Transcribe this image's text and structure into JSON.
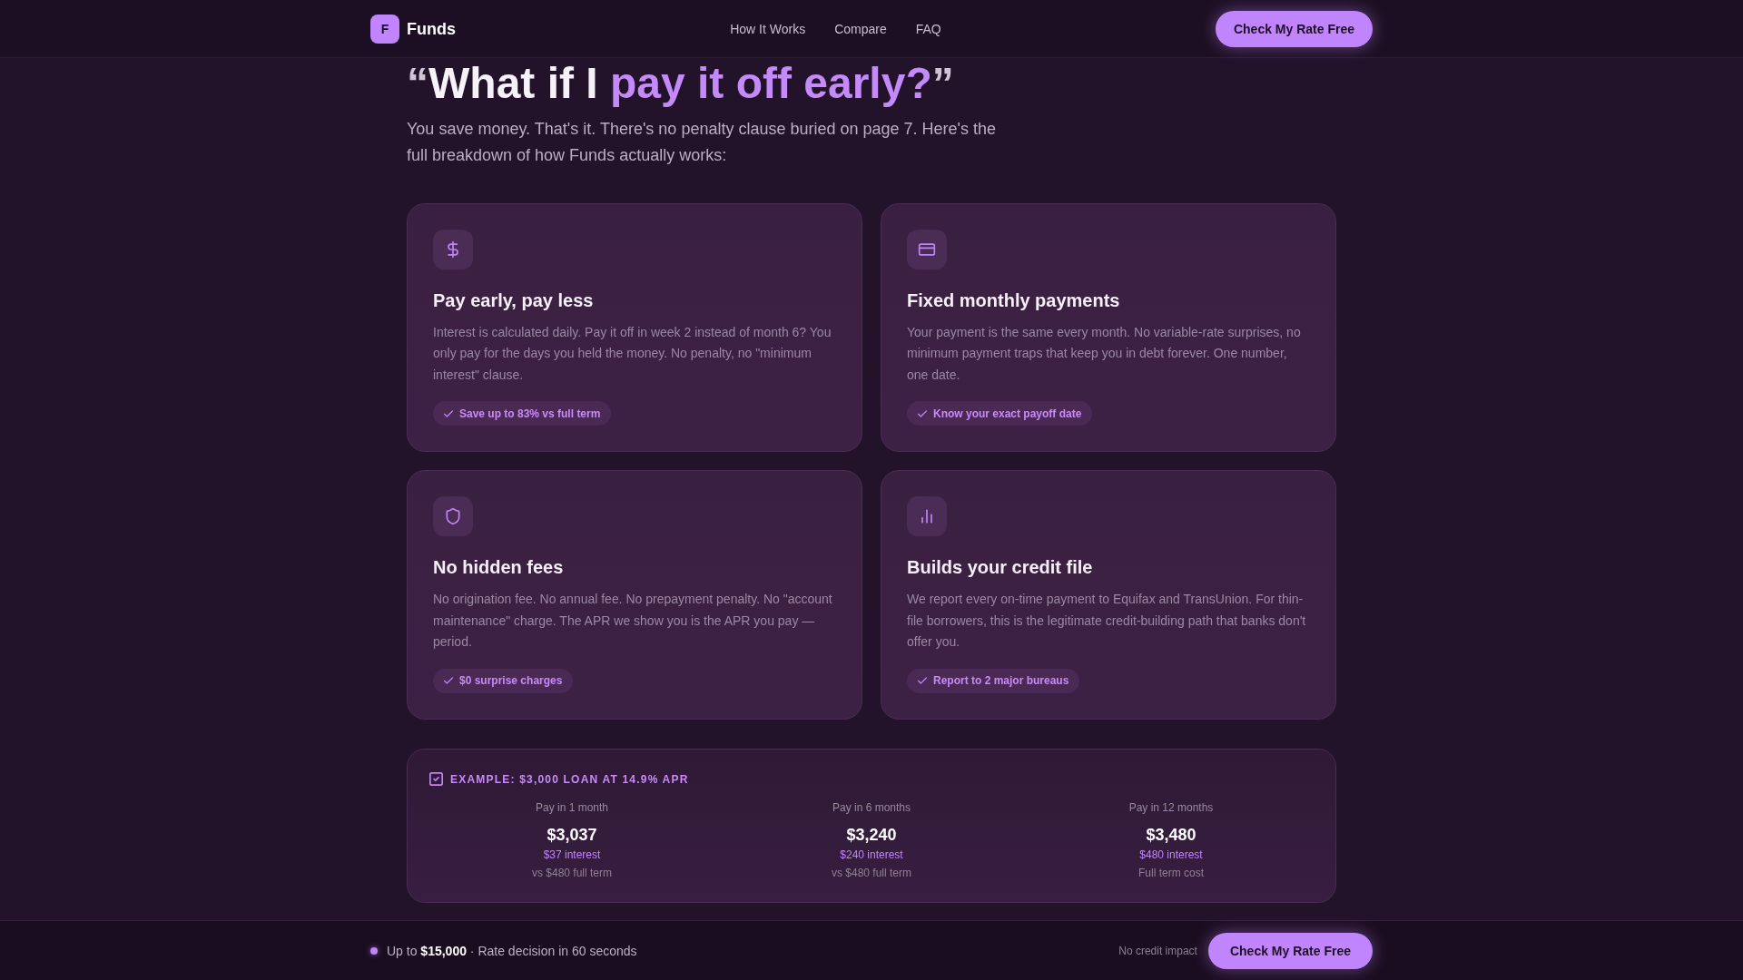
{
  "header": {
    "logo_mark": "F",
    "brand": "Funds",
    "nav": [
      "How It Works",
      "Compare",
      "FAQ"
    ],
    "cta": "Check My Rate Free"
  },
  "hero": {
    "headline": {
      "open_quote": "“",
      "lead": "What if I ",
      "highlight": "pay it off early?",
      "close_quote": "”"
    },
    "intro": "You save money. That's it. There's no penalty clause buried on page 7. Here's the full breakdown of how Funds actually works:"
  },
  "features": [
    {
      "title": "Pay early, pay less",
      "body": "Interest is calculated daily. Pay it off in week 2 instead of month 6? You only pay for the days you held the money. No penalty, no \"minimum interest\" clause.",
      "badge": "Save up to 83% vs full term"
    },
    {
      "title": "Fixed monthly payments",
      "body": "Your payment is the same every month. No variable-rate surprises, no minimum payment traps that keep you in debt forever. One number, one date.",
      "badge": "Know your exact payoff date"
    },
    {
      "title": "No hidden fees",
      "body": "No origination fee. No annual fee. No prepayment penalty. No \"account maintenance\" charge. The APR we show you is the APR you pay — period.",
      "badge": "$0 surprise charges"
    },
    {
      "title": "Builds your credit file",
      "body": "We report every on-time payment to Equifax and TransUnion. For thin-file borrowers, this is the legitimate credit-building path that banks don't offer you.",
      "badge": "Report to 2 major bureaus"
    }
  ],
  "example": {
    "title": "EXAMPLE: $3,000 LOAN AT 14.9% APR",
    "options": [
      {
        "label": "Pay in 1 month",
        "total": "$3,037",
        "interest": "$37 interest",
        "comparison": "vs $480 full term"
      },
      {
        "label": "Pay in 6 months",
        "total": "$3,240",
        "interest": "$240 interest",
        "comparison": "vs $480 full term"
      },
      {
        "label": "Pay in 12 months",
        "total": "$3,480",
        "interest": "$480 interest",
        "comparison": "Full term cost"
      }
    ]
  },
  "footer": {
    "summary": "Up to **$15,000** · Rate decision in 60 seconds",
    "note": "No credit impact",
    "cta": "Check My Rate Free"
  }
}
